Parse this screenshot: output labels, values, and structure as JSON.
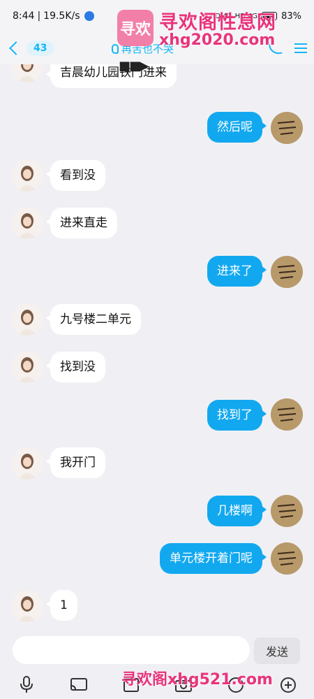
{
  "status_bar": {
    "time": "8:44",
    "speed": "19.5K/s",
    "network_labels": "HD 4G HD 4G",
    "battery": "83%"
  },
  "header": {
    "unread_count": "43",
    "title": "再苦也不哭",
    "icons": {
      "back": "chevron-left-icon",
      "phone": "phone-icon",
      "menu": "menu-icon",
      "ear": "ear-icon"
    }
  },
  "watermarks": {
    "logo_text": "寻欢",
    "site_name": "寻欢阁性息网",
    "url_top": "xhg2020.com",
    "url_bottom": "寻欢阁xhg521.com"
  },
  "messages": [
    {
      "side": "in",
      "text": "吉晨幼儿园铁门进来"
    },
    {
      "side": "out",
      "text": "然后呢"
    },
    {
      "side": "in",
      "text": "看到没"
    },
    {
      "side": "in",
      "text": "进来直走"
    },
    {
      "side": "out",
      "text": "进来了"
    },
    {
      "side": "in",
      "text": "九号楼二单元"
    },
    {
      "side": "in",
      "text": "找到没"
    },
    {
      "side": "out",
      "text": "找到了"
    },
    {
      "side": "in",
      "text": "我开门"
    },
    {
      "side": "out",
      "text": "几楼啊"
    },
    {
      "side": "out",
      "text": "单元楼开着门呢"
    },
    {
      "side": "in",
      "text": "1"
    }
  ],
  "composer": {
    "placeholder": "",
    "send_label": "发送"
  },
  "toolbar": [
    "microphone-icon",
    "screen-cast-icon",
    "image-icon",
    "camera-icon",
    "emoji-icon",
    "plus-icon"
  ],
  "colors": {
    "accent": "#12b7f5",
    "bubble_out": "#12a8f0",
    "watermark": "#e8347c"
  }
}
